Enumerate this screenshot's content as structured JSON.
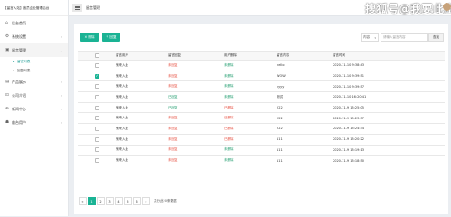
{
  "app": {
    "title": "【留言入站】追员企业管理后台"
  },
  "sidebar": {
    "items": [
      {
        "icon": "⌂",
        "label": "后台首页"
      },
      {
        "icon": "⚙",
        "label": "系统设置",
        "arrow": "‹"
      },
      {
        "icon": "▣",
        "label": "留言管理",
        "arrow": "⌄"
      },
      {
        "icon": "▤",
        "label": "产品展示",
        "arrow": "‹"
      },
      {
        "icon": "⊡",
        "label": "公司介绍",
        "arrow": "‹"
      },
      {
        "icon": "⊕",
        "label": "新闻中心",
        "arrow": "‹"
      },
      {
        "icon": "☗",
        "label": "前台用户",
        "arrow": "‹"
      }
    ],
    "subitems": [
      {
        "icon": "▪",
        "label": "留言列表"
      },
      {
        "icon": "▫",
        "label": "回复列表"
      }
    ]
  },
  "header": {
    "tab": "留言管理",
    "watermark": "搜狐号@我要此出"
  },
  "toolbar": {
    "delete_label": "删除",
    "fill_label": "回复",
    "select_value": "内容",
    "search_placeholder": "请输入留言内容",
    "search_button": "查找"
  },
  "table": {
    "headers": [
      "留言用户",
      "留言回复",
      "用户删除",
      "留言内容",
      "留言时间"
    ],
    "rows": [
      {
        "checked": false,
        "user": "骗来入此",
        "reply": "未回复",
        "del": "未删除",
        "content": "hello",
        "time": "2020-11-10 9:38:43"
      },
      {
        "checked": true,
        "user": "骗来入此",
        "reply": "未回复",
        "del": "未删除",
        "content": "WOW",
        "time": "2020-11-10 9:39:51"
      },
      {
        "checked": false,
        "user": "骗来入此",
        "reply": "未回复",
        "del": "未删除",
        "content": "yyyy",
        "time": "2020-11-10 9:39:57"
      },
      {
        "checked": false,
        "user": "骗来入此",
        "reply": "已回复",
        "del": "未删除",
        "content": "测试",
        "time": "2020-11-10 16:20:41"
      },
      {
        "checked": false,
        "user": "骗来入此",
        "reply": "已回复",
        "del": "已删除",
        "content": "222",
        "time": "2020-11-9 15:25:05"
      },
      {
        "checked": false,
        "user": "骗来入此",
        "reply": "未回复",
        "del": "已删除",
        "content": "222",
        "time": "2020-11-9 15:23:57"
      },
      {
        "checked": false,
        "user": "骗来入此",
        "reply": "未回复",
        "del": "已删除",
        "content": "222",
        "time": "2020-11-9 15:24:34"
      },
      {
        "checked": false,
        "user": "骗来入此",
        "reply": "未回复",
        "del": "已删除",
        "content": "111",
        "time": "2020-11-9 15:20:22"
      },
      {
        "checked": false,
        "user": "骗来入此",
        "reply": "未回复",
        "del": "未删除",
        "content": "111",
        "time": "2020-11-9 15:19:13"
      },
      {
        "checked": false,
        "user": "骗来入此",
        "reply": "未回复",
        "del": "未删除",
        "content": "111",
        "time": "2020-11-9 15:18:50"
      }
    ]
  },
  "pagination": {
    "prev": "«",
    "pages": [
      "1",
      "2",
      "3",
      "4",
      "5",
      "6"
    ],
    "next": "»",
    "info": "共分此20条数据",
    "current": "1"
  },
  "colors": {
    "accent": "#1ab394",
    "red": "#e64b3c",
    "green": "#1a9a6a"
  }
}
